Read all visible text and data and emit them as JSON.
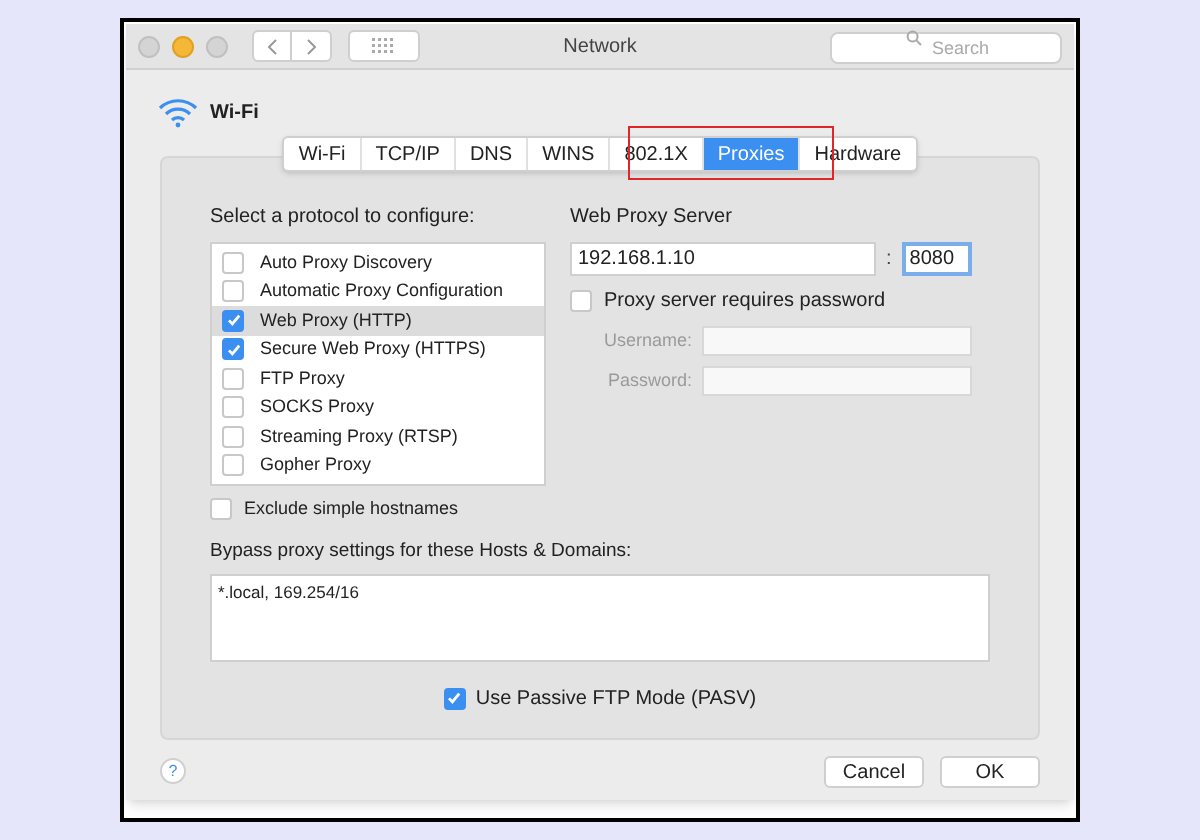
{
  "window": {
    "title": "Network",
    "search": {
      "placeholder": "Search"
    }
  },
  "interface": {
    "name": "Wi-Fi"
  },
  "tabs": [
    {
      "label": "Wi-Fi",
      "selected": false
    },
    {
      "label": "TCP/IP",
      "selected": false
    },
    {
      "label": "DNS",
      "selected": false
    },
    {
      "label": "WINS",
      "selected": false
    },
    {
      "label": "802.1X",
      "selected": false
    },
    {
      "label": "Proxies",
      "selected": true
    },
    {
      "label": "Hardware",
      "selected": false
    }
  ],
  "protocols": {
    "label": "Select a protocol to configure:",
    "items": [
      {
        "label": "Auto Proxy Discovery",
        "checked": false,
        "selected": false
      },
      {
        "label": "Automatic Proxy Configuration",
        "checked": false,
        "selected": false
      },
      {
        "label": "Web Proxy (HTTP)",
        "checked": true,
        "selected": true
      },
      {
        "label": "Secure Web Proxy (HTTPS)",
        "checked": true,
        "selected": false
      },
      {
        "label": "FTP Proxy",
        "checked": false,
        "selected": false
      },
      {
        "label": "SOCKS Proxy",
        "checked": false,
        "selected": false
      },
      {
        "label": "Streaming Proxy (RTSP)",
        "checked": false,
        "selected": false
      },
      {
        "label": "Gopher Proxy",
        "checked": false,
        "selected": false
      }
    ]
  },
  "server": {
    "label": "Web Proxy Server",
    "host": "192.168.1.10",
    "separator": ":",
    "port": "8080",
    "requires_password": {
      "label": "Proxy server requires password",
      "checked": false
    },
    "credentials": [
      {
        "label": "Username:",
        "disabled": true
      },
      {
        "label": "Password:",
        "disabled": true
      }
    ]
  },
  "exclude_simple": {
    "label": "Exclude simple hostnames",
    "checked": false
  },
  "bypass": {
    "label": "Bypass proxy settings for these Hosts & Domains:",
    "value": "*.local, 169.254/16"
  },
  "passive_ftp": {
    "label": "Use Passive FTP Mode (PASV)",
    "checked": true
  },
  "help": "?",
  "buttons": [
    "Cancel",
    "OK"
  ]
}
